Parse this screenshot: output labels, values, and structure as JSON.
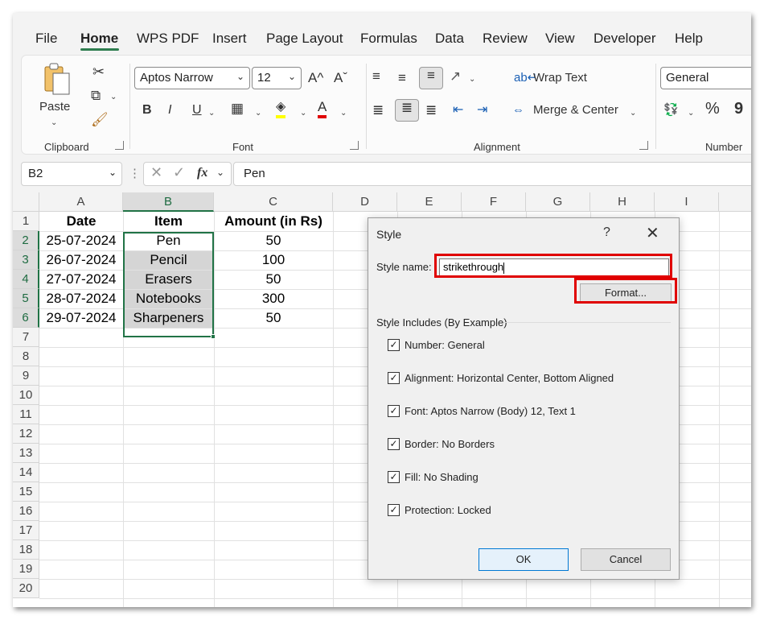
{
  "menu": {
    "tabs": [
      "File",
      "Home",
      "WPS PDF",
      "Insert",
      "Page Layout",
      "Formulas",
      "Data",
      "Review",
      "View",
      "Developer",
      "Help"
    ],
    "active": "Home"
  },
  "ribbon": {
    "clipboard": {
      "paste_label": "Paste",
      "group_label": "Clipboard"
    },
    "font": {
      "font_name": "Aptos Narrow",
      "font_size": "12",
      "bold": "B",
      "italic": "I",
      "underline": "U",
      "group_label": "Font"
    },
    "alignment": {
      "wrap_text": "Wrap Text",
      "merge_center": "Merge & Center",
      "group_label": "Alignment"
    },
    "number": {
      "format": "General",
      "percent": "%",
      "comma": "9",
      "group_label": "Number"
    }
  },
  "formula_bar": {
    "name_box": "B2",
    "fx": "fx",
    "value": "Pen"
  },
  "sheet": {
    "columns": [
      "A",
      "B",
      "C",
      "D",
      "E",
      "F",
      "G",
      "H",
      "I"
    ],
    "rows": [
      "1",
      "2",
      "3",
      "4",
      "5",
      "6",
      "7",
      "8",
      "9",
      "10",
      "11",
      "12",
      "13",
      "14",
      "15",
      "16",
      "17",
      "18",
      "19",
      "20"
    ],
    "headers": [
      "Date",
      "Item",
      "Amount (in Rs)"
    ],
    "data": [
      [
        "25-07-2024",
        "Pen",
        "50"
      ],
      [
        "26-07-2024",
        "Pencil",
        "100"
      ],
      [
        "27-07-2024",
        "Erasers",
        "50"
      ],
      [
        "28-07-2024",
        "Notebooks",
        "300"
      ],
      [
        "29-07-2024",
        "Sharpeners",
        "50"
      ]
    ]
  },
  "dialog": {
    "title": "Style",
    "help": "?",
    "close": "✕",
    "style_name_label": "Style name:",
    "style_name_value": "strikethrough",
    "format_button": "Format...",
    "includes_label": "Style Includes (By Example)",
    "options": [
      {
        "label": "Number: General",
        "checked": true
      },
      {
        "label": "Alignment: Horizontal Center, Bottom Aligned",
        "checked": true
      },
      {
        "label": "Font: Aptos Narrow (Body) 12, Text 1",
        "checked": true
      },
      {
        "label": "Border: No Borders",
        "checked": true
      },
      {
        "label": "Fill: No Shading",
        "checked": true
      },
      {
        "label": "Protection: Locked",
        "checked": true
      }
    ],
    "ok": "OK",
    "cancel": "Cancel"
  },
  "colors": {
    "accent_green": "#217346",
    "highlight_red": "#e00000",
    "selected_fill": "#d5d5d5"
  }
}
